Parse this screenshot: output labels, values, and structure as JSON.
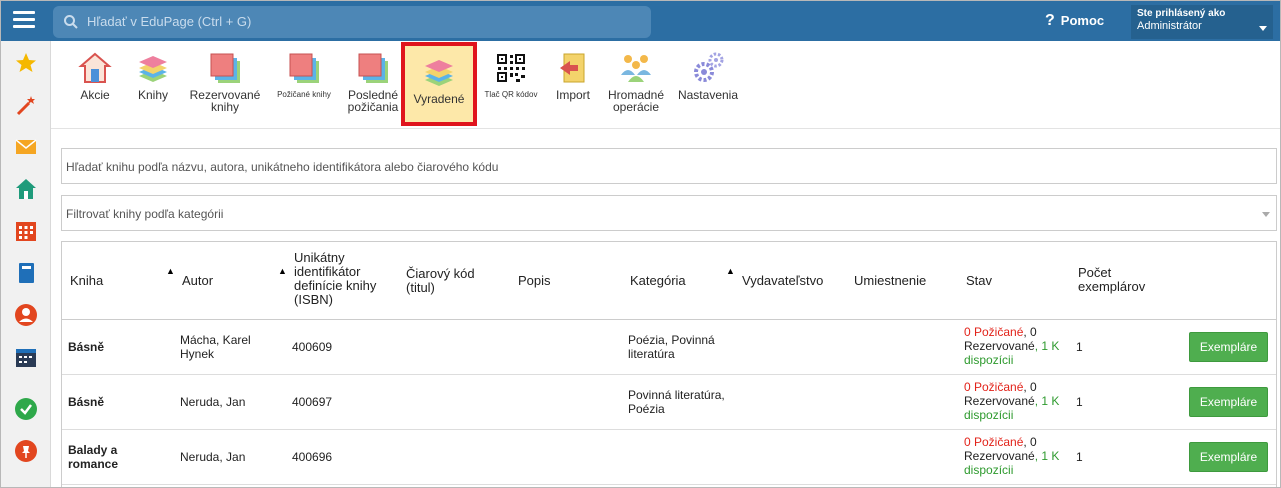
{
  "topbar": {
    "search_placeholder": "Hľadať v EduPage (Ctrl + G)",
    "help": "Pomoc",
    "user_line1": "Ste prihlásený ako",
    "user_line2": "Administrátor"
  },
  "rail": {
    "icons": [
      "star-icon",
      "magic-wand-icon",
      "mail-icon",
      "home-icon",
      "calendar-grid-icon",
      "book-icon",
      "user-icon",
      "clock-calendar-icon",
      "check-icon",
      "pin-icon"
    ]
  },
  "toolbar": {
    "items": [
      {
        "label": "Akcie"
      },
      {
        "label": "Knihy"
      },
      {
        "label": "Rezervované knihy"
      },
      {
        "label": "Požičané knihy"
      },
      {
        "label": "Posledné požičania"
      },
      {
        "label": "Vyradené"
      },
      {
        "label": "Tlač QR kódov"
      },
      {
        "label": "Import"
      },
      {
        "label": "Hromadné operácie"
      },
      {
        "label": "Nastavenia"
      }
    ]
  },
  "filters": {
    "search_placeholder": "Hľadať knihu podľa názvu, autora, unikátneho identifikátora alebo čiarového kódu",
    "category_placeholder": "Filtrovať knihy podľa kategórii"
  },
  "table": {
    "headers": {
      "book": "Kniha",
      "author": "Autor",
      "isbn": "Unikátny identifikátor definície knihy (ISBN)",
      "barcode": "Čiarový kód (titul)",
      "desc": "Popis",
      "category": "Kategória",
      "publisher": "Vydavateľstvo",
      "location": "Umiestnenie",
      "status": "Stav",
      "count": "Počet exemplárov"
    },
    "rows": [
      {
        "book": "Básně",
        "author": "Mácha, Karel Hynek",
        "isbn": "400609",
        "category": "Poézia, Povinná literatúra",
        "borrowed": "0 Požičané",
        "reserved_num": ", 0",
        "reserved": "Rezervované",
        "available": ", 1 K dispozícii",
        "count": "1",
        "button": "Exempláre"
      },
      {
        "book": "Básně",
        "author": "Neruda, Jan",
        "isbn": "400697",
        "category": "Povinná literatúra, Poézia",
        "borrowed": "0 Požičané",
        "reserved_num": ", 0",
        "reserved": "Rezervované",
        "available": ", 1 K dispozícii",
        "count": "1",
        "button": "Exempláre"
      },
      {
        "book": "Balady a romance",
        "author": "Neruda, Jan",
        "isbn": "400696",
        "category": "",
        "borrowed": "0 Požičané",
        "reserved_num": ", 0",
        "reserved": "Rezervované",
        "available": ", 1 K dispozícii",
        "count": "1",
        "button": "Exempláre"
      }
    ]
  },
  "colors": {
    "topbar": "#2c6ea3",
    "active_tool_bg": "#fde8a9",
    "active_tool_border": "#e0141d",
    "button_green": "#4fae4f",
    "status_red": "#e2231a",
    "status_green": "#2e9a2e"
  }
}
